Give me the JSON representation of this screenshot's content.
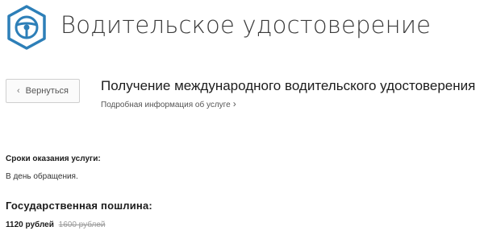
{
  "header": {
    "title": "Водительское удостоверение",
    "icon": "steering-wheel-icon",
    "accent_color": "#2d7fb8"
  },
  "nav": {
    "back_label": "Вернуться"
  },
  "service": {
    "title": "Получение международного водительского удостоверения",
    "details_link": "Подробная информация об услуге"
  },
  "terms": {
    "label": "Сроки оказания услуги:",
    "value": "В день обращения."
  },
  "fee": {
    "label": "Государственная пошлина:",
    "price": "1120 рублей",
    "old_price": "1600 рублей"
  }
}
